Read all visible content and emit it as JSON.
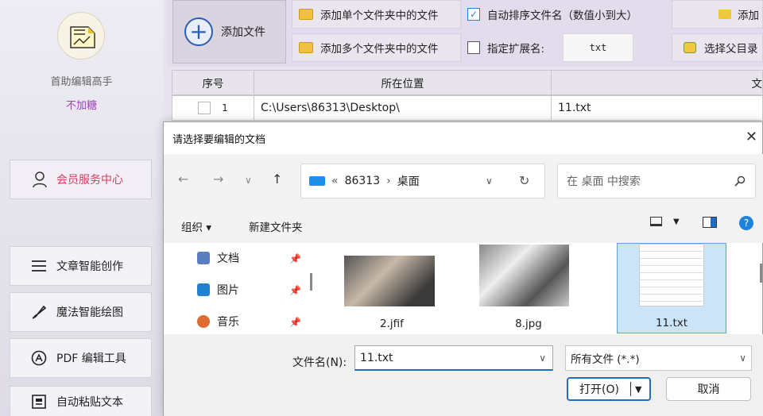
{
  "sidebar": {
    "app_name": "首助编辑高手",
    "author": "不加糖",
    "member_label": "会员服务中心",
    "items": [
      {
        "label": "文章智能创作",
        "icon": "list-icon"
      },
      {
        "label": "魔法智能绘图",
        "icon": "brush-icon"
      },
      {
        "label": "PDF 编辑工具",
        "icon": "pdf-icon"
      },
      {
        "label": "自动粘贴文本",
        "icon": "paste-icon"
      }
    ]
  },
  "toolbar": {
    "add_file": "添加文件",
    "add_single_folder": "添加单个文件夹中的文件",
    "add_multi_folder": "添加多个文件夹中的文件",
    "auto_sort": "自动排序文件名（数值小到大）",
    "auto_sort_checked": true,
    "ext_label": "指定扩展名:",
    "ext_checked": false,
    "ext_value": "txt",
    "right_top": "添加",
    "right_bottom": "选择父目录"
  },
  "table": {
    "headers": [
      "序号",
      "所在位置",
      "文"
    ],
    "rows": [
      {
        "index": "1",
        "location": "C:\\Users\\86313\\Desktop\\",
        "name": "11.txt"
      }
    ]
  },
  "dialog": {
    "title": "请选择要编辑的文档",
    "breadcrumb_prefix": "«",
    "breadcrumb_user": "86313",
    "breadcrumb_sep": "›",
    "breadcrumb_current": "桌面",
    "search_placeholder": "在 桌面 中搜索",
    "organize": "组织 ▾",
    "new_folder": "新建文件夹",
    "nav_items": [
      {
        "label": "文档",
        "icon": "documents-icon",
        "color": "#5a7fc0"
      },
      {
        "label": "图片",
        "icon": "pictures-icon",
        "color": "#1e82d0"
      },
      {
        "label": "音乐",
        "icon": "music-icon",
        "color": "#e06a30"
      }
    ],
    "files": [
      {
        "name": "2.jfif",
        "type": "image"
      },
      {
        "name": "8.jpg",
        "type": "image"
      },
      {
        "name": "11.txt",
        "type": "text",
        "selected": true
      }
    ],
    "filename_label": "文件名(N):",
    "filename_value": "11.txt",
    "filetype_value": "所有文件 (*.*)",
    "open_label": "打开(O)",
    "cancel_label": "取消"
  }
}
